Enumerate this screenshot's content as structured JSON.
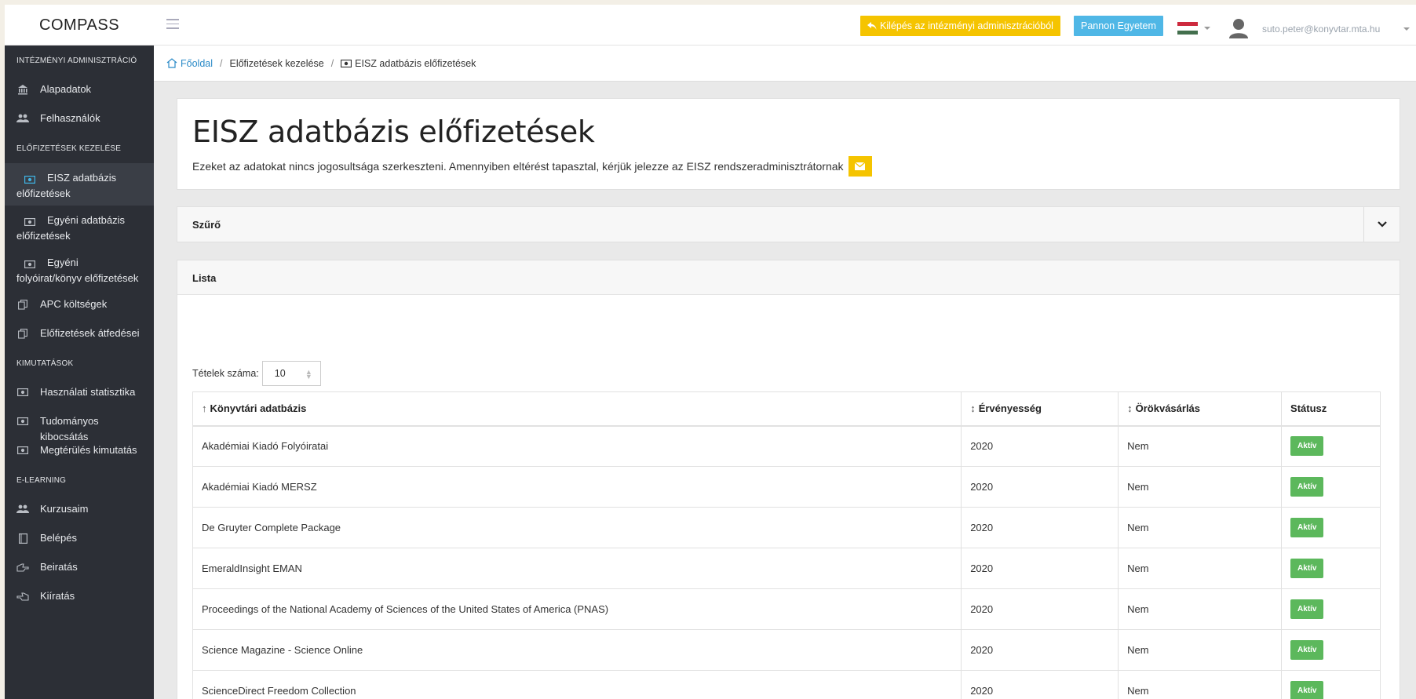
{
  "brand": "COMPASS",
  "topbar": {
    "exit_label": "Kilépés az intézményi adminisztrációból",
    "institution_label": "Pannon Egyetem",
    "user_email": "suto.peter@konyvtar.mta.hu",
    "flag_colors": [
      "#cd2a3e",
      "#ffffff",
      "#436f4d"
    ]
  },
  "sidebar": {
    "sections": [
      {
        "title": "INTÉZMÉNYI ADMINISZTRÁCIÓ",
        "items": [
          {
            "label": "Alapadatok",
            "icon": "bank-icon"
          },
          {
            "label": "Felhasználók",
            "icon": "users-icon"
          }
        ]
      },
      {
        "title": "ELŐFIZETÉSEK KEZELÉSE",
        "items": [
          {
            "label": "EISZ adatbázis előfizetések",
            "icon": "money-icon",
            "active": true
          },
          {
            "label": "Egyéni adatbázis előfizetések",
            "icon": "money-icon"
          },
          {
            "label": "Egyéni folyóirat/könyv előfizetések",
            "icon": "money-icon"
          },
          {
            "label": "APC költségek",
            "icon": "copy-icon"
          },
          {
            "label": "Előfizetések átfedései",
            "icon": "copy-icon"
          }
        ]
      },
      {
        "title": "KIMUTATÁSOK",
        "items": [
          {
            "label": "Használati statisztika",
            "icon": "money-icon"
          },
          {
            "label": "Tudományos kibocsátás",
            "icon": "money-icon"
          },
          {
            "label": "Megtérülés kimutatás",
            "icon": "money-icon"
          }
        ]
      },
      {
        "title": "E-LEARNING",
        "items": [
          {
            "label": "Kurzusaim",
            "icon": "users-icon"
          },
          {
            "label": "Belépés",
            "icon": "book-icon"
          },
          {
            "label": "Beiratás",
            "icon": "hand-right-icon"
          },
          {
            "label": "Kiíratás",
            "icon": "hand-left-icon"
          }
        ]
      }
    ]
  },
  "breadcrumb": {
    "home": "Főoldal",
    "middle": "Előfizetések kezelése",
    "current": "EISZ adatbázis előfizetések"
  },
  "page": {
    "title": "EISZ adatbázis előfizetések",
    "note": "Ezeket az adatokat nincs jogosultsága szerkeszteni. Amennyiben eltérést tapasztal, kérjük jelezze az EISZ rendszeradminisztrátornak"
  },
  "filter": {
    "title": "Szűrő"
  },
  "list": {
    "title": "Lista",
    "per_page_label": "Tételek száma:",
    "per_page_value": "10",
    "columns": [
      {
        "label": "Könyvtári adatbázis",
        "sort": "↑"
      },
      {
        "label": "Érvényesség",
        "sort": "↕"
      },
      {
        "label": "Örökvásárlás",
        "sort": "↕"
      },
      {
        "label": "Státusz",
        "sort": ""
      }
    ],
    "rows": [
      {
        "name": "Akadémiai Kiadó Folyóiratai",
        "year": "2020",
        "perpetual": "Nem",
        "status": "Aktív"
      },
      {
        "name": "Akadémiai Kiadó MERSZ",
        "year": "2020",
        "perpetual": "Nem",
        "status": "Aktív"
      },
      {
        "name": "De Gruyter Complete Package",
        "year": "2020",
        "perpetual": "Nem",
        "status": "Aktív"
      },
      {
        "name": "EmeraldInsight EMAN",
        "year": "2020",
        "perpetual": "Nem",
        "status": "Aktív"
      },
      {
        "name": "Proceedings of the National Academy of Sciences of the United States of America (PNAS)",
        "year": "2020",
        "perpetual": "Nem",
        "status": "Aktív"
      },
      {
        "name": "Science Magazine - Science Online",
        "year": "2020",
        "perpetual": "Nem",
        "status": "Aktív"
      },
      {
        "name": "ScienceDirect Freedom Collection",
        "year": "2020",
        "perpetual": "Nem",
        "status": "Aktív"
      }
    ]
  }
}
